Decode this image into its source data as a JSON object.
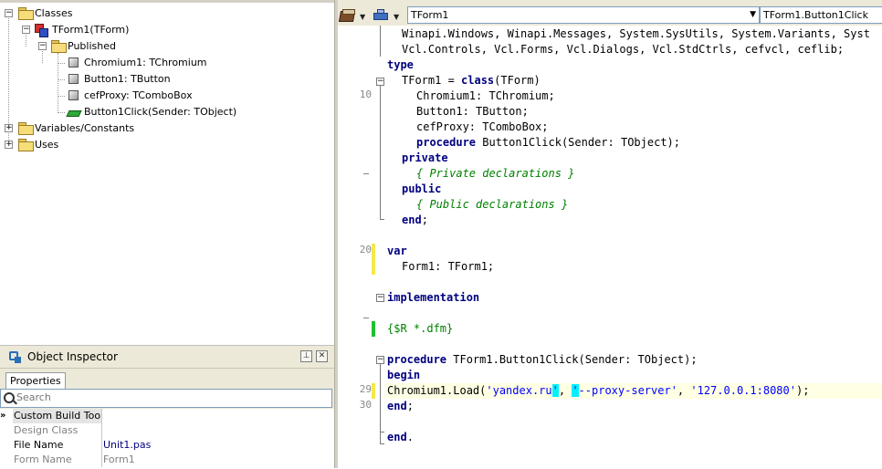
{
  "structure": {
    "root_label": "Classes",
    "form_label": "TForm1(TForm)",
    "published_label": "Published",
    "members": [
      "Chromium1: TChromium",
      "Button1: TButton",
      "cefProxy: TComboBox",
      "Button1Click(Sender: TObject)"
    ],
    "variables_label": "Variables/Constants",
    "uses_label": "Uses"
  },
  "inspector": {
    "title": "Object Inspector",
    "tab": "Properties",
    "search_placeholder": "Search",
    "properties": [
      {
        "name": "Custom Build Tool",
        "value": ""
      },
      {
        "name": "Design Class",
        "value": ""
      },
      {
        "name": "File Name",
        "value": "Unit1.pas"
      },
      {
        "name": "Form Name",
        "value": "Form1"
      }
    ]
  },
  "editor": {
    "class_combo": "TForm1",
    "method_combo": "TForm1.Button1Click",
    "line_numbers": [
      "10",
      "20",
      "29",
      "30"
    ]
  },
  "code": {
    "uses1": "Winapi.Windows, Winapi.Messages, System.SysUtils, System.Variants, Syst",
    "uses2": "Vcl.Controls, Vcl.Forms, Vcl.Dialogs, Vcl.StdCtrls, cefvcl, ceflib;",
    "kw_type": "type",
    "l3_a": "TForm1 = ",
    "kw_class": "class",
    "l3_b": "(TForm)",
    "chromium": "Chromium1: TChromium;",
    "button": "Button1: TButton;",
    "proxy": "cefProxy: TComboBox;",
    "kw_procedure": "procedure",
    "decl": " Button1Click(Sender: TObject);",
    "kw_private": "private",
    "cm_private": "{ Private declarations }",
    "kw_public": "public",
    "cm_public": "{ Public declarations }",
    "kw_end": "end",
    "semicolon": ";",
    "kw_var": "var",
    "form_var": "Form1: TForm1;",
    "kw_implementation": "implementation",
    "directive": "{$R *.dfm}",
    "impl_proc": " TForm1.Button1Click(Sender: TObject);",
    "kw_begin": "begin",
    "load_a": "Chromium1.Load(",
    "str1": "'yandex.ru",
    "q1": "'",
    "sep1": ", ",
    "q2": "'",
    "str2": "--proxy-server'",
    "sep2": ", ",
    "str3": "'127.0.0.1:8080'",
    "load_end": ");",
    "end_dot": "."
  }
}
